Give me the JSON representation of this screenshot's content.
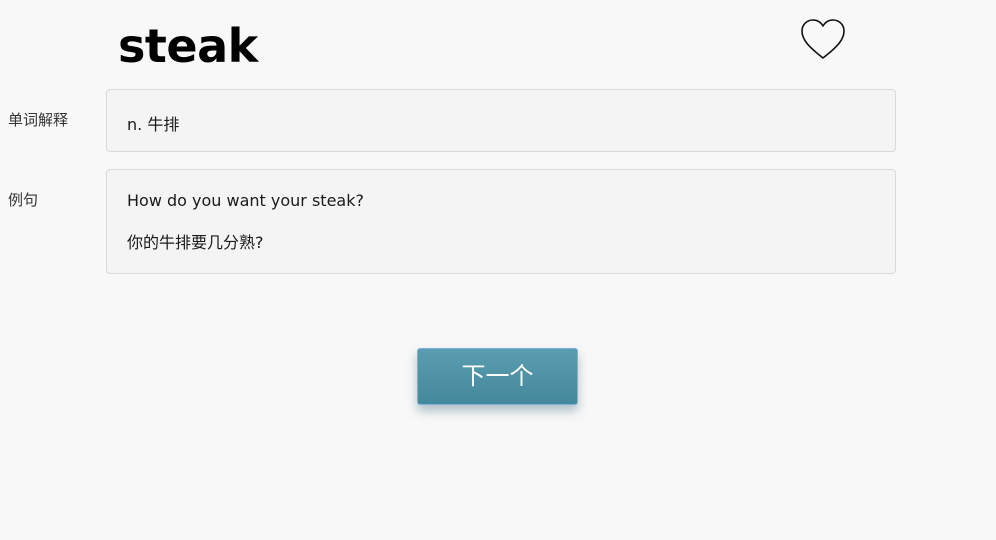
{
  "word": {
    "title": "steak"
  },
  "favorite": {
    "icon": "heart-outline-icon",
    "stroke_color": "#111111"
  },
  "definition": {
    "label": "单词解释",
    "value": "n. 牛排"
  },
  "example": {
    "label": "例句",
    "sentence_en": "How do you want your steak?",
    "sentence_zh": "你的牛排要几分熟?"
  },
  "actions": {
    "next_label": "下一个",
    "next_color": "#4f93a6"
  }
}
